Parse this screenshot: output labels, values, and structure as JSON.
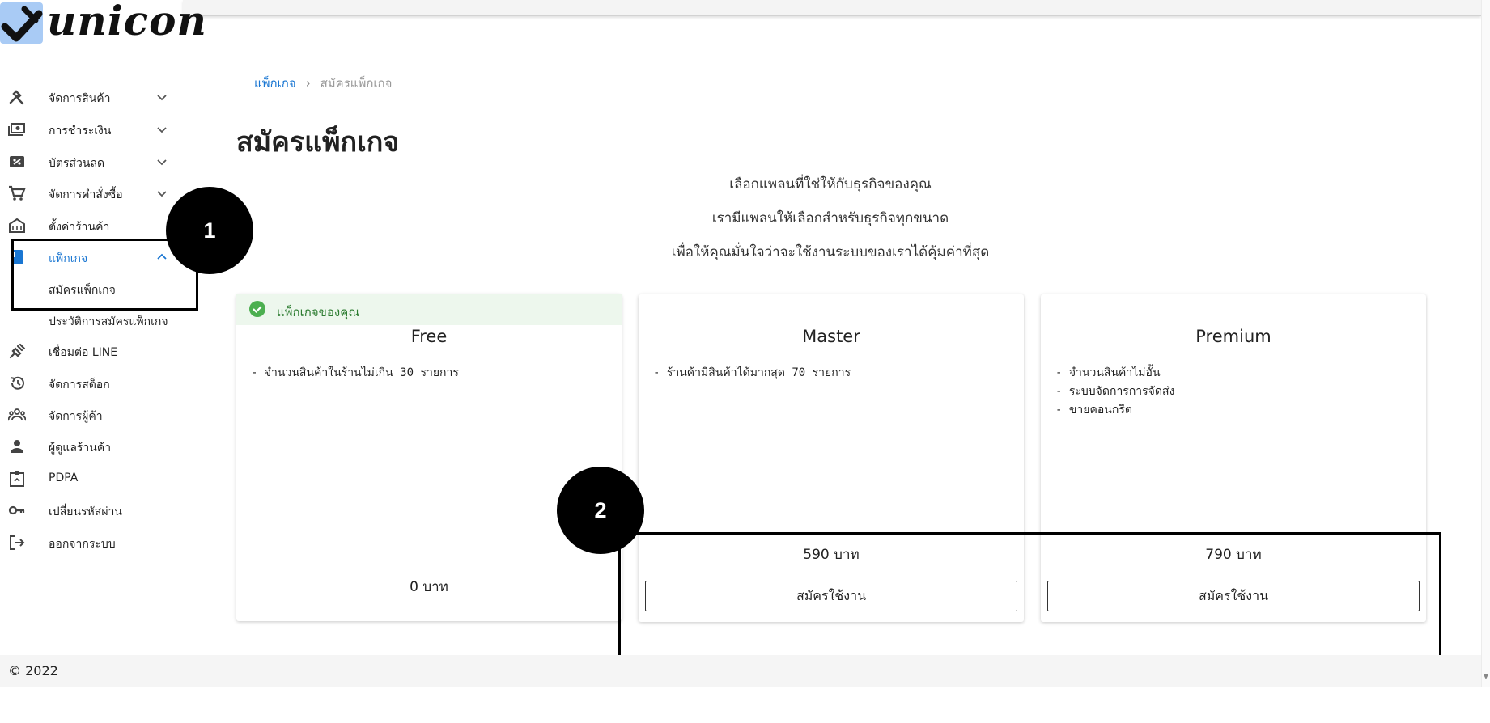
{
  "brand": {
    "logo_text": "unicon"
  },
  "sidebar": {
    "items": [
      {
        "label": "จัดการสินค้า",
        "icon": "tools-icon"
      },
      {
        "label": "การชำระเงิน",
        "icon": "money-icon"
      },
      {
        "label": "บัตรส่วนลด",
        "icon": "discount-icon"
      },
      {
        "label": "จัดการคำสั่งซื้อ",
        "icon": "cart-icon"
      },
      {
        "label": "ตั้งค่าร้านค้า",
        "icon": "store-icon"
      },
      {
        "label": "แพ็กเกจ",
        "icon": "book-icon"
      },
      {
        "label": "สมัครแพ็กเกจ"
      },
      {
        "label": "ประวัติการสมัครแพ็กเกจ"
      },
      {
        "label": "เชื่อมต่อ LINE",
        "icon": "plug-icon"
      },
      {
        "label": "จัดการสต็อก",
        "icon": "restore-icon"
      },
      {
        "label": "จัดการผู้ค้า",
        "icon": "group-icon"
      },
      {
        "label": "ผู้ดูแลร้านค้า",
        "icon": "person-icon"
      },
      {
        "label": "PDPA",
        "icon": "clipboard-icon"
      },
      {
        "label": "เปลี่ยนรหัสผ่าน",
        "icon": "key-icon"
      },
      {
        "label": "ออกจากระบบ",
        "icon": "logout-icon"
      }
    ]
  },
  "annotations": {
    "one": "1",
    "two": "2"
  },
  "breadcrumb": {
    "parent": "แพ็กเกจ",
    "separator": "›",
    "current": "สมัครแพ็กเกจ"
  },
  "main": {
    "title": "สมัครแพ็กเกจ",
    "intro": [
      "เลือกแพลนที่ใช่ให้กับธุรกิจของคุณ",
      "เรามีแพลนให้เลือกสำหรับธุรกิจทุกขนาด",
      "เพื่อให้คุณมั่นใจว่าจะใช้งานระบบของเราได้คุ้มค่าที่สุด"
    ],
    "current_label": "แพ็กเกจของคุณ",
    "plans": [
      {
        "name": "Free",
        "features": [
          "- จำนวนสินค้าในร้านไม่เกิน 30 รายการ"
        ],
        "price": "0 บาท"
      },
      {
        "name": "Master",
        "features": [
          "- ร้านค้ามีสินค้าได้มากสุด 70 รายการ"
        ],
        "price": "590 บาท",
        "button": "สมัครใช้งาน"
      },
      {
        "name": "Premium",
        "features": [
          "- จำนวนสินค้าไม่อั้น",
          "- ระบบจัดการการจัดส่ง",
          "- ขายคอนกรีต"
        ],
        "price": "790 บาท",
        "button": "สมัครใช้งาน"
      }
    ]
  },
  "footer": {
    "copyright": "© 2022"
  },
  "colors": {
    "accent": "#1976d2",
    "success": "#2e7d32",
    "success_bg": "#edf7ed",
    "logo_bg": "#a9cbf5"
  }
}
